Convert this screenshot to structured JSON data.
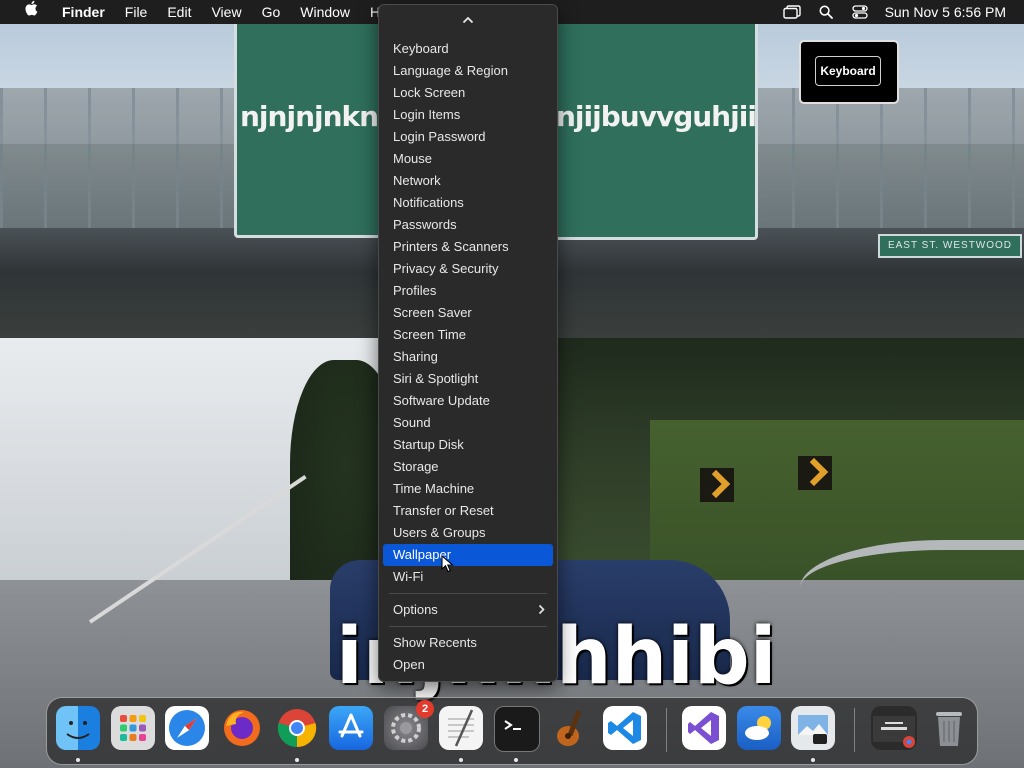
{
  "menubar": {
    "app_name": "Finder",
    "menus": [
      "File",
      "Edit",
      "View",
      "Go",
      "Window",
      "Hel"
    ],
    "clock": "Sun Nov 5  6:56 PM",
    "icons": [
      "apple-icon",
      "window-switcher-icon",
      "spotlight-search-icon",
      "control-center-icon"
    ]
  },
  "wallpaper": {
    "sign_left_text": "njnjnjnknkn",
    "sign_right_text": "njijbuvvguhjii",
    "small_sign_text": "EAST ST. WESTWOOD",
    "bottom_caption": "injnnhhibi"
  },
  "tooltip": {
    "label": "Keyboard"
  },
  "dropdown": {
    "items": [
      "Keyboard",
      "Language & Region",
      "Lock Screen",
      "Login Items",
      "Login Password",
      "Mouse",
      "Network",
      "Notifications",
      "Passwords",
      "Printers & Scanners",
      "Privacy & Security",
      "Profiles",
      "Screen Saver",
      "Screen Time",
      "Sharing",
      "Siri & Spotlight",
      "Software Update",
      "Sound",
      "Startup Disk",
      "Storage",
      "Time Machine",
      "Transfer or Reset",
      "Users & Groups",
      "Wallpaper",
      "Wi-Fi"
    ],
    "selected": "Wallpaper",
    "options_label": "Options",
    "show_recents_label": "Show Recents",
    "open_label": "Open"
  },
  "dock": {
    "apps": [
      {
        "name": "finder",
        "color": "#2b8de0"
      },
      {
        "name": "launchpad",
        "color": "#d8d8d8"
      },
      {
        "name": "safari",
        "color": "#2a7de1"
      },
      {
        "name": "firefox",
        "color": "#e8621c"
      },
      {
        "name": "chrome",
        "color": "#ffffff"
      },
      {
        "name": "app-store",
        "color": "#1d8cf0"
      },
      {
        "name": "system-settings",
        "color": "#6e6e72",
        "badge": "2"
      },
      {
        "name": "textedit",
        "color": "#f3f3f3"
      },
      {
        "name": "terminal",
        "color": "#1c1c1c"
      },
      {
        "name": "garageband",
        "color": "#c9792a"
      },
      {
        "name": "vscode",
        "color": "#ffffff"
      },
      {
        "name": "visual-studio",
        "color": "#ffffff"
      },
      {
        "name": "weather",
        "color": "#2f7fd8"
      },
      {
        "name": "preview",
        "color": "#e4e8ec"
      },
      {
        "name": "chrome-window",
        "color": "#2b2b2b"
      },
      {
        "name": "trash",
        "color": "#8c8f93"
      }
    ]
  }
}
